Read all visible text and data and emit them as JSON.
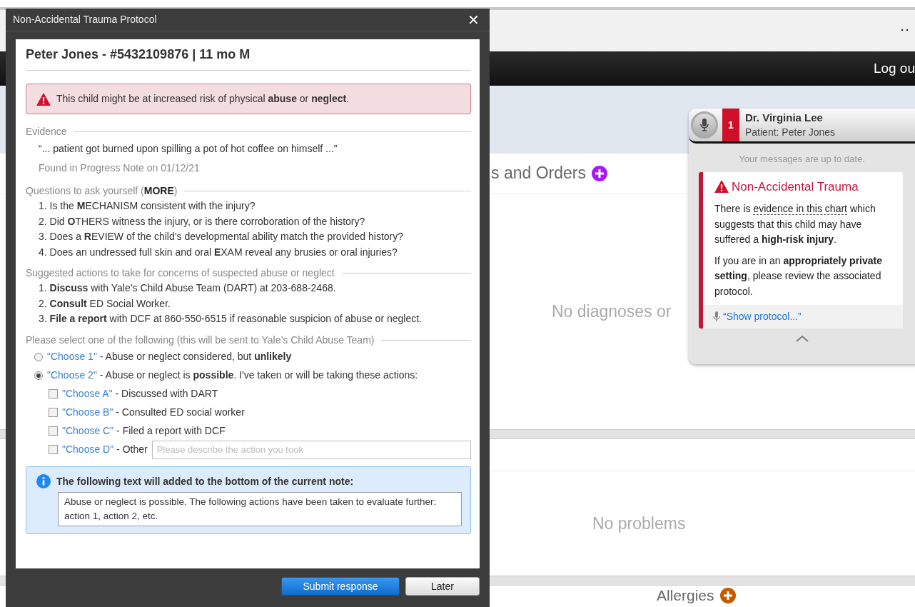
{
  "background": {
    "logout": "Log ou",
    "orders_title": "s and Orders",
    "diagnoses_empty": "No diagnoses or",
    "problems_empty": "No problems",
    "allergies_title": "Allergies"
  },
  "dialog": {
    "title": "Non-Accidental Trauma Protocol",
    "close": "✕",
    "patient": "Peter Jones - #5432109876 | 11 mo M",
    "alert": "This child might be at increased risk of physical **abuse** or **neglect**.",
    "evidence": {
      "heading": "Evidence",
      "quote": "“... patient got burned upon spilling a pot of hot coffee on himself ...”",
      "source": "Found in Progress Note on 01/12/21"
    },
    "questions": {
      "heading": "Questions to ask yourself (**MORE**)",
      "items": [
        "1. Is the **M**ECHANISM consistent with the injury?",
        "2. Did **O**THERS witness the injury, or is there corroboration of the history?",
        "3. Does a **R**EVIEW of the child’s developmental ability match the provided history?",
        "4. Does an undressed full skin and oral **E**XAM reveal any brusies or oral injuries?"
      ]
    },
    "actions": {
      "heading": "Suggested actions to take for concerns of suspected abuse or neglect",
      "items": [
        "1. **Discuss** with Yale’s Child Abuse Team (DART) at 203-688-2468.",
        "2. **Consult** ED Social Worker.",
        "3. **File a report** with DCF at 860-550-6515 if reasonable suspicion of abuse or neglect."
      ]
    },
    "select_heading": "Please select one of the following (this will be sent to Yale’s Child Abuse Team)",
    "options": [
      {
        "command": "\"Choose 1\"",
        "text": "- Abuse or neglect considered, but **unlikely**",
        "selected": false
      },
      {
        "command": "\"Choose 2\"",
        "text": "- Abuse or neglect is **possible**. I've taken or will be taking these actions:",
        "selected": true
      }
    ],
    "checks": [
      {
        "command": "\"Choose A\"",
        "text": "- Discussed with DART",
        "checked": false
      },
      {
        "command": "\"Choose B\"",
        "text": "- Consulted ED social worker",
        "checked": false
      },
      {
        "command": "\"Choose C\"",
        "text": "- Filed a report with DCF",
        "checked": false
      },
      {
        "command": "\"Choose D\"",
        "text": "- Other",
        "checked": false,
        "placeholder": "Please describe the action you took"
      }
    ],
    "note": {
      "heading": "The following text will added to the bottom of the current note:",
      "text": "Abuse or neglect is possible. The following actions have been taken to evaluate further: action 1, action 2, etc."
    },
    "buttons": [
      {
        "label": "Submit response",
        "kind": "primary"
      },
      {
        "label": "Later",
        "kind": "secondary"
      }
    ]
  },
  "popup": {
    "doctor": "Dr. Virginia Lee",
    "patient": "Patient: Peter Jones",
    "badge": "1",
    "status": "Your messages are up to date.",
    "card": {
      "title": "Non-Accidental Trauma",
      "p1_before": "There is ",
      "p1_link": "evidence in this chart",
      "p1_after": " which suggests that this child may have suffered a **high-risk injury**.",
      "p2": "If you are in an **appropriately private setting**, please review the associated protocol.",
      "command": "“Show protocol...”"
    }
  }
}
